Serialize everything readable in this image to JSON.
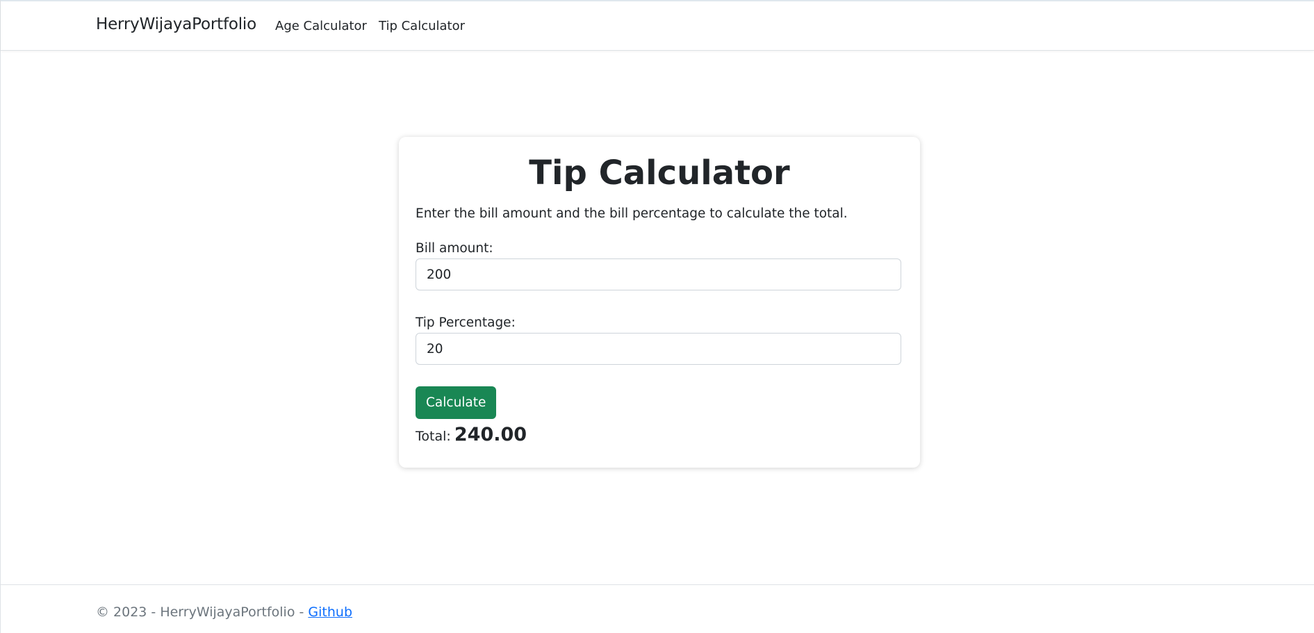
{
  "navbar": {
    "brand": "HerryWijayaPortfolio",
    "links": [
      {
        "label": "Age Calculator"
      },
      {
        "label": "Tip Calculator"
      }
    ]
  },
  "card": {
    "title": "Tip Calculator",
    "description": "Enter the bill amount and the bill percentage to calculate the total.",
    "bill": {
      "label": "Bill amount:",
      "value": "200"
    },
    "tip": {
      "label": "Tip Percentage:",
      "value": "20"
    },
    "button_label": "Calculate",
    "total": {
      "label": "Total:",
      "value": "240.00"
    }
  },
  "footer": {
    "text": "© 2023 - HerryWijayaPortfolio - ",
    "link_label": "Github"
  },
  "colors": {
    "button": "#198754",
    "link": "#0d6efd",
    "footer_text": "#6c757d",
    "text": "#212529"
  }
}
